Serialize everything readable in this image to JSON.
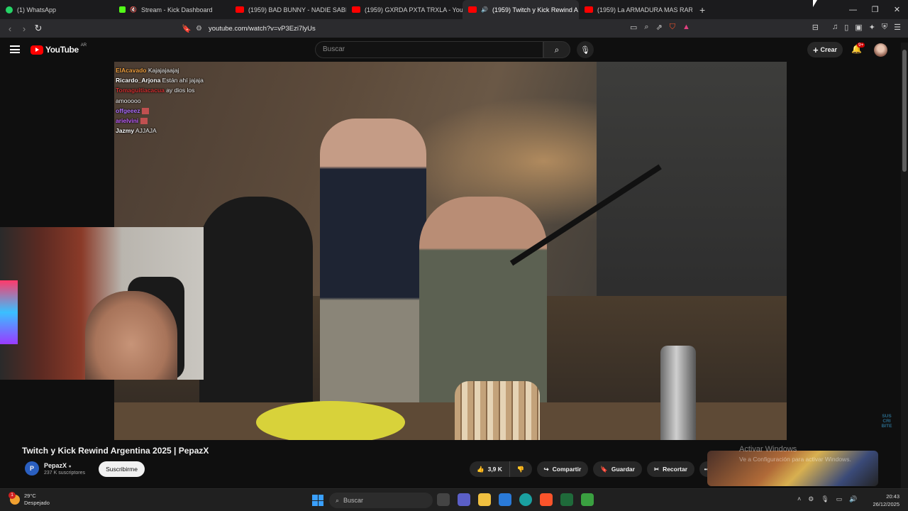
{
  "browser": {
    "tabs": [
      {
        "title": "(1) WhatsApp",
        "favicon_color": "#25d366"
      },
      {
        "title": "Stream - Kick Dashboard",
        "favicon_color": "#53fc18"
      },
      {
        "title": "(1959) BAD BUNNY - NADIE SABE (V",
        "favicon_color": "#ff0000"
      },
      {
        "title": "(1959) GXRDA PXTA TRXLA - YouTub",
        "favicon_color": "#ff0000"
      },
      {
        "title": "(1959) Twitch y Kick Rewind A",
        "favicon_color": "#ff0000",
        "active": true
      },
      {
        "title": "(1959) La ARMADURA MAS RARA de",
        "favicon_color": "#ff0000"
      }
    ],
    "new_tab": "+",
    "url": "youtube.com/watch?v=vP3Ezi7lyUs"
  },
  "youtube": {
    "logo_text": "YouTube",
    "country_code": "AR",
    "search_placeholder": "Buscar",
    "create_label": "Crear",
    "notif_badge": "9+"
  },
  "chat": [
    {
      "user": "ElAcavado",
      "msg": "Kajajajaajaj",
      "color": "#f0a040"
    },
    {
      "user": "Ricardo_Arjona",
      "msg": "Están ahí jajaja",
      "color": "#ffffff"
    },
    {
      "user": "Tomaguitiacacua",
      "msg": "ay dios los",
      "color": "#d03030"
    },
    {
      "user": "",
      "msg": "amooooo",
      "color": "#ffffff"
    },
    {
      "user": "offgeeez",
      "msg": "",
      "color": "#b070ff"
    },
    {
      "user": "arielvini",
      "msg": "",
      "color": "#c060ff"
    },
    {
      "user": "Jazmy",
      "msg": "AJJAJA",
      "color": "#ffffff"
    }
  ],
  "overlay_badge": "SUS CRI BITE",
  "video": {
    "title": "Twitch y Kick Rewind Argentina 2025 | PepazX",
    "channel": "PepazX",
    "subscribers": "237 K suscriptores",
    "subscribe_label": "Suscribirme",
    "likes": "3,9 K",
    "share_label": "Compartir",
    "save_label": "Guardar",
    "clip_label": "Recortar"
  },
  "watermark": {
    "line1": "Activar Windows",
    "line2": "Ve a Configuración para activar Windows."
  },
  "taskbar": {
    "temp": "29°C",
    "weather": "Despejado",
    "weather_badge": "1",
    "search": "Buscar",
    "time": "20:43",
    "date": "26/12/2025"
  }
}
